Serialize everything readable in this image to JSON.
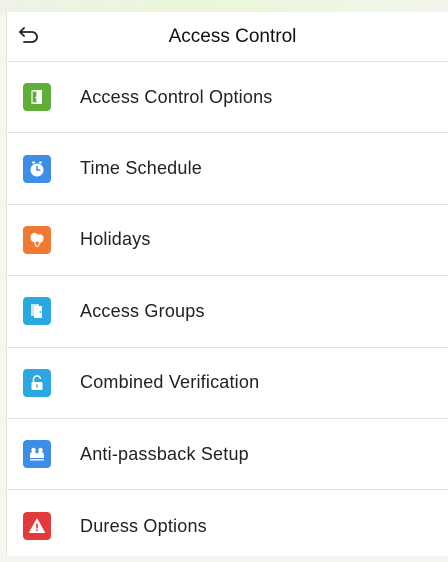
{
  "header": {
    "title": "Access Control"
  },
  "menu": {
    "items": [
      {
        "label": "Access Control Options",
        "icon": "door-icon",
        "color": "#5fae3a"
      },
      {
        "label": "Time Schedule",
        "icon": "clock-icon",
        "color": "#3c8ee6"
      },
      {
        "label": "Holidays",
        "icon": "balloons-icon",
        "color": "#f07a33"
      },
      {
        "label": "Access Groups",
        "icon": "doors-group-icon",
        "color": "#2ba7e2"
      },
      {
        "label": "Combined Verification",
        "icon": "unlock-icon",
        "color": "#2ba7e2"
      },
      {
        "label": "Anti-passback Setup",
        "icon": "people-icon",
        "color": "#3c8ee6"
      },
      {
        "label": "Duress Options",
        "icon": "warning-icon",
        "color": "#e23b3b"
      }
    ]
  }
}
